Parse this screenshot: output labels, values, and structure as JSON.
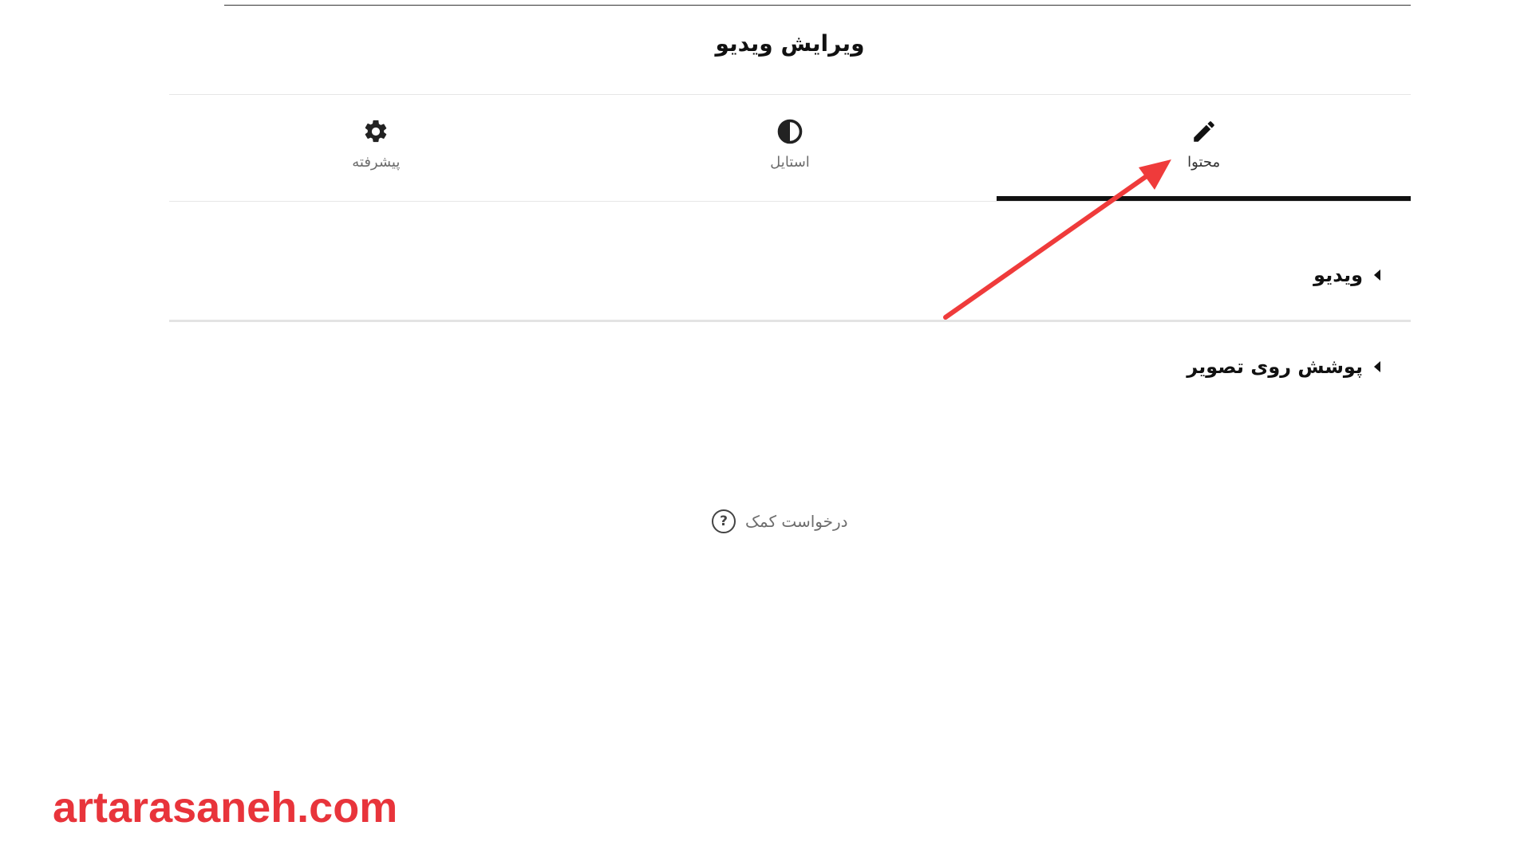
{
  "panel": {
    "title": "ویرایش ویدیو"
  },
  "tabs": [
    {
      "label": "محتوا",
      "icon": "pencil-icon",
      "active": true
    },
    {
      "label": "استایل",
      "icon": "contrast-icon",
      "active": false
    },
    {
      "label": "پیشرفته",
      "icon": "gear-icon",
      "active": false
    }
  ],
  "sections": [
    {
      "label": "ویدیو",
      "icon": "caret-left-icon"
    },
    {
      "label": "پوشش روی تصویر",
      "icon": "caret-left-icon"
    }
  ],
  "help": {
    "label": "درخواست کمک",
    "icon": "question-circle-icon"
  },
  "watermark": {
    "text": "artarasaneh.com",
    "color": "#e8343b"
  },
  "colors": {
    "accent": "#111111",
    "arrow": "#ef3b3b"
  }
}
